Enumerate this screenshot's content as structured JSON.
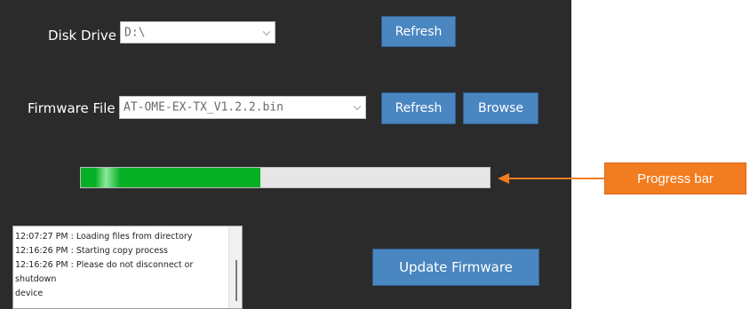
{
  "disk_drive": {
    "label": "Disk Drive :",
    "value": "D:\\",
    "refresh_label": "Refresh"
  },
  "firmware": {
    "label": "Firmware File :",
    "value": "AT-OME-EX-TX_V1.2.2.bin",
    "refresh_label": "Refresh",
    "browse_label": "Browse"
  },
  "progress": {
    "fraction": 0.44
  },
  "log": {
    "lines": [
      "12:07:27 PM : Loading files from directory",
      "12:16:26 PM : Starting copy process",
      "12:16:26 PM : Please do not disconnect or shutdown",
      "device"
    ]
  },
  "update_button_label": "Update Firmware",
  "annotation": {
    "callout_text": "Progress bar",
    "color": "#f27c20"
  },
  "colors": {
    "window_bg": "#2b2b2b",
    "button_bg": "#4a86c0",
    "progress_fill": "#06b025"
  }
}
